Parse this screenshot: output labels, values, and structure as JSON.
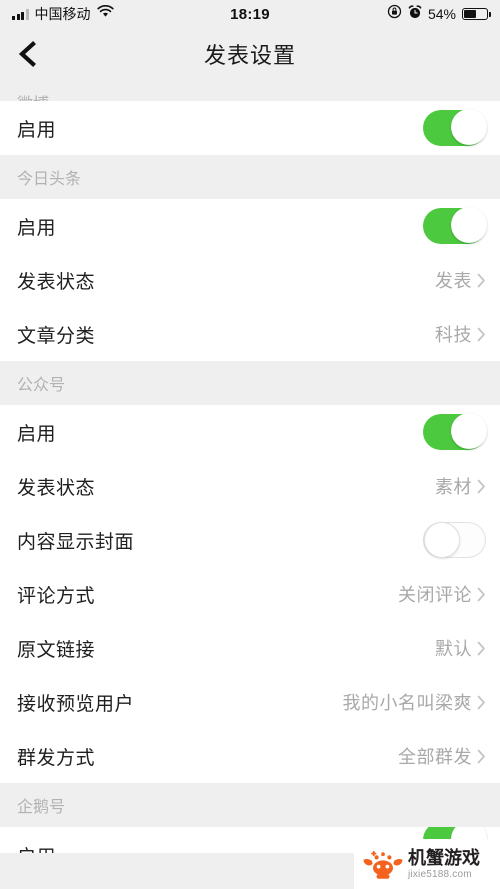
{
  "status_bar": {
    "carrier": "中国移动",
    "time": "18:19",
    "battery_percent": "54%",
    "battery_level": 54,
    "icons": [
      "signal-bars-icon",
      "wifi-icon",
      "rotation-lock-icon",
      "alarm-clock-icon",
      "battery-icon"
    ]
  },
  "nav": {
    "title": "发表设置",
    "back_label": "返回"
  },
  "sections": [
    {
      "header": "微博",
      "clipped": true,
      "rows": [
        {
          "label": "启用",
          "type": "switch",
          "value": "on"
        }
      ]
    },
    {
      "header": "今日头条",
      "clipped": false,
      "rows": [
        {
          "label": "启用",
          "type": "switch",
          "value": "on"
        },
        {
          "label": "发表状态",
          "type": "link",
          "value": "发表"
        },
        {
          "label": "文章分类",
          "type": "link",
          "value": "科技"
        }
      ]
    },
    {
      "header": "公众号",
      "clipped": false,
      "rows": [
        {
          "label": "启用",
          "type": "switch",
          "value": "on"
        },
        {
          "label": "发表状态",
          "type": "link",
          "value": "素材"
        },
        {
          "label": "内容显示封面",
          "type": "switch",
          "value": "off"
        },
        {
          "label": "评论方式",
          "type": "link",
          "value": "关闭评论"
        },
        {
          "label": "原文链接",
          "type": "link",
          "value": "默认"
        },
        {
          "label": "接收预览用户",
          "type": "link",
          "value": "我的小名叫梁爽"
        },
        {
          "label": "群发方式",
          "type": "link",
          "value": "全部群发"
        }
      ]
    },
    {
      "header": "企鹅号",
      "clipped": false,
      "rows": [
        {
          "label": "启用",
          "type": "switch",
          "value": "on",
          "clipped": true
        }
      ]
    }
  ],
  "watermark": {
    "title": "机蟹游戏",
    "url": "jixie5188.com",
    "logo_color": "#f4631e"
  },
  "colors": {
    "switch_on": "#4cc93f",
    "page_background": "#efeff0",
    "row_background": "#ffffff",
    "value_text": "#a9a9a9",
    "section_header_text": "#b2b2b2"
  }
}
